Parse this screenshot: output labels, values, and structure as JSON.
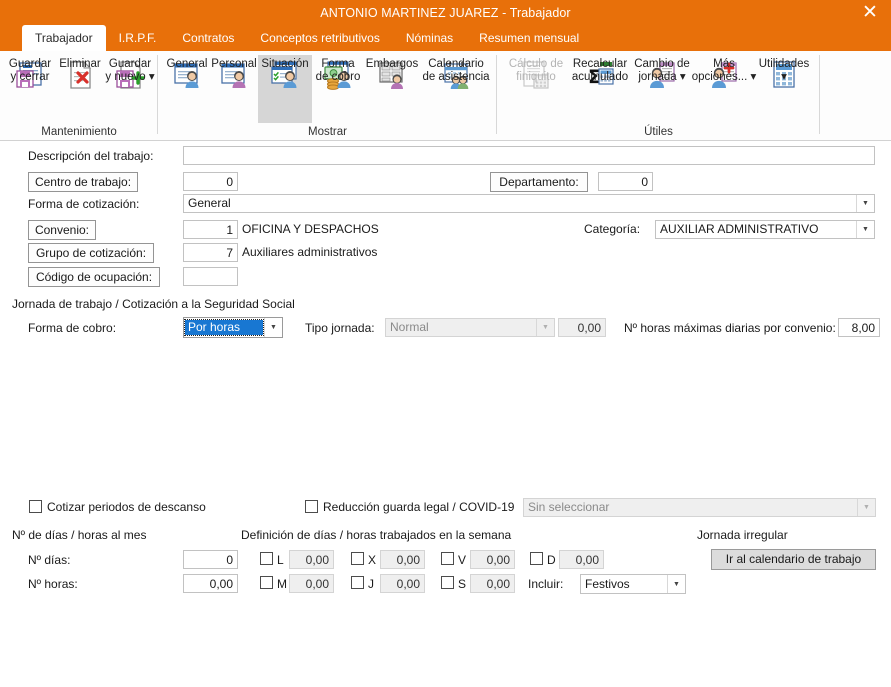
{
  "window": {
    "title": "ANTONIO MARTINEZ JUAREZ - Trabajador",
    "close_label": "✕",
    "accent_color": "#E8700A"
  },
  "tabs": [
    {
      "label": "Trabajador",
      "active": true
    },
    {
      "label": "I.R.P.F.",
      "active": false
    },
    {
      "label": "Contratos",
      "active": false
    },
    {
      "label": "Conceptos retributivos",
      "active": false
    },
    {
      "label": "Nóminas",
      "active": false
    },
    {
      "label": "Resumen mensual",
      "active": false
    }
  ],
  "ribbon": {
    "groups": [
      {
        "name": "Mantenimiento",
        "items": [
          {
            "label": "Guardar\ny cerrar",
            "icon": "save-close-icon",
            "state": "normal"
          },
          {
            "label": "Eliminar",
            "icon": "delete-icon",
            "state": "normal"
          },
          {
            "label": "Guardar\ny nuevo ▾",
            "icon": "save-new-icon",
            "state": "normal"
          }
        ]
      },
      {
        "name": "Mostrar",
        "items": [
          {
            "label": "General",
            "icon": "general-person-icon",
            "state": "normal"
          },
          {
            "label": "Personal",
            "icon": "personal-person-icon",
            "state": "normal"
          },
          {
            "label": "Situación",
            "icon": "situacion-person-icon",
            "state": "selected"
          },
          {
            "label": "Forma\nde cobro",
            "icon": "forma-cobro-icon",
            "state": "normal"
          },
          {
            "label": "Embargos",
            "icon": "embargos-icon",
            "state": "normal"
          },
          {
            "label": "Calendario\nde asistencia",
            "icon": "calendario-asistencia-icon",
            "state": "normal"
          }
        ]
      },
      {
        "name": "Útiles",
        "items": [
          {
            "label": "Cálculo de\nfiniquito",
            "icon": "calculo-finiquito-icon",
            "state": "disabled"
          },
          {
            "label": "Recalcular\nacumulado",
            "icon": "recalcular-acumulado-icon",
            "state": "normal"
          },
          {
            "label": "Cambio de\njornada ▾",
            "icon": "cambio-jornada-icon",
            "state": "normal"
          },
          {
            "label": "Más\nopciones... ▾",
            "icon": "mas-opciones-icon",
            "state": "normal"
          },
          {
            "label": "Utilidades\n▾",
            "icon": "utilidades-icon",
            "state": "normal"
          }
        ]
      }
    ]
  },
  "form": {
    "descripcion_label": "Descripción del trabajo:",
    "descripcion_value": "",
    "centro_trabajo_label": "Centro de trabajo:",
    "centro_trabajo_value": "0",
    "departamento_label": "Departamento:",
    "departamento_value": "0",
    "forma_cotizacion_label": "Forma de cotización:",
    "forma_cotizacion_value": "General",
    "convenio_label": "Convenio:",
    "convenio_code": "1",
    "convenio_text": "OFICINA Y DESPACHOS",
    "categoria_label": "Categoría:",
    "categoria_value": "AUXILIAR ADMINISTRATIVO",
    "grupo_cotizacion_label": "Grupo de cotización:",
    "grupo_cotizacion_code": "7",
    "grupo_cotizacion_text": "Auxiliares administrativos",
    "codigo_ocupacion_label": "Código de ocupación:",
    "codigo_ocupacion_value": "",
    "jornada_section_title": "Jornada de trabajo / Cotización a la Seguridad Social",
    "forma_cobro_label": "Forma de cobro:",
    "forma_cobro_value": "Por horas",
    "tipo_jornada_label": "Tipo jornada:",
    "tipo_jornada_value": "Normal",
    "tipo_jornada_num": "0,00",
    "horas_max_label": "Nº horas máximas diarias por convenio:",
    "horas_max_value": "8,00",
    "cotizar_descanso_label": "Cotizar periodos de descanso",
    "cotizar_descanso_checked": false,
    "reduccion_label": "Reducción guarda legal / COVID-19",
    "reduccion_checked": false,
    "reduccion_select_value": "Sin seleccionar",
    "dias_horas_mes_title": "Nº de días / horas al mes",
    "n_dias_label": "Nº días:",
    "n_dias_value": "0",
    "n_horas_label": "Nº horas:",
    "n_horas_value": "0,00",
    "definicion_title": "Definición de días / horas trabajados en la semana",
    "weekdays": [
      {
        "code": "L",
        "value": "0,00",
        "checked": false
      },
      {
        "code": "M",
        "value": "0,00",
        "checked": false
      },
      {
        "code": "X",
        "value": "0,00",
        "checked": false
      },
      {
        "code": "J",
        "value": "0,00",
        "checked": false
      },
      {
        "code": "V",
        "value": "0,00",
        "checked": false
      },
      {
        "code": "S",
        "value": "0,00",
        "checked": false
      },
      {
        "code": "D",
        "value": "0,00",
        "checked": false
      }
    ],
    "incluir_label": "Incluir:",
    "incluir_value": "Festivos",
    "jornada_irregular_title": "Jornada irregular",
    "ir_calendario_label": "Ir al calendario de trabajo"
  }
}
